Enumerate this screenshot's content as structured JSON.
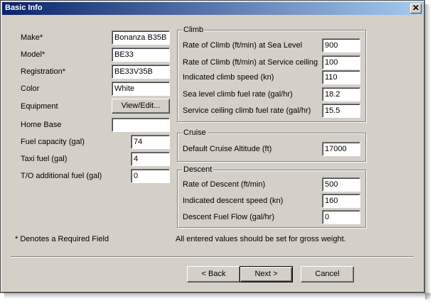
{
  "window": {
    "title": "Basic Info",
    "close_glyph": "✕"
  },
  "aircraft": {
    "make_label": "Make*",
    "make_value": "Bonanza B35B",
    "model_label": "Model*",
    "model_value": "BE33",
    "registration_label": "Registration*",
    "registration_value": "BE33V35B",
    "color_label": "Color",
    "color_value": "White",
    "equipment_label": "Equipment",
    "equipment_button": "View/Edit...",
    "home_base_label": "Home Base",
    "home_base_value": "",
    "fuel_capacity_label": "Fuel capacity (gal)",
    "fuel_capacity_value": "74",
    "taxi_fuel_label": "Taxi fuel (gal)",
    "taxi_fuel_value": "4",
    "to_fuel_label": "T/O additional fuel (gal)",
    "to_fuel_value": "0"
  },
  "climb": {
    "title": "Climb",
    "rate_sea_label": "Rate of Climb (ft/min) at Sea Level",
    "rate_sea_value": "900",
    "rate_ceiling_label": "Rate of Climb (ft/min) at Service ceiling",
    "rate_ceiling_value": "100",
    "speed_label": "Indicated climb speed (kn)",
    "speed_value": "110",
    "fuel_sea_label": "Sea level climb fuel rate (gal/hr)",
    "fuel_sea_value": "18.2",
    "fuel_ceiling_label": "Service ceiling climb fuel rate (gal/hr)",
    "fuel_ceiling_value": "15.5"
  },
  "cruise": {
    "title": "Cruise",
    "altitude_label": "Default Cruise Altitude (ft)",
    "altitude_value": "17000"
  },
  "descent": {
    "title": "Descent",
    "rate_label": "Rate of Descent (ft/min)",
    "rate_value": "500",
    "speed_label": "Indicated descent speed (kn)",
    "speed_value": "160",
    "fuel_label": "Descent Fuel Flow (gal/hr)",
    "fuel_value": "0"
  },
  "notes": {
    "required": "* Denotes a Required Field",
    "gross_weight": "All entered values should be set for gross weight."
  },
  "buttons": {
    "back": "< Back",
    "next": "Next >",
    "cancel": "Cancel"
  },
  "colors": {
    "titlebar_start": "#0a246a",
    "titlebar_end": "#a6caf0",
    "dialog_bg": "#d4d0c8"
  }
}
